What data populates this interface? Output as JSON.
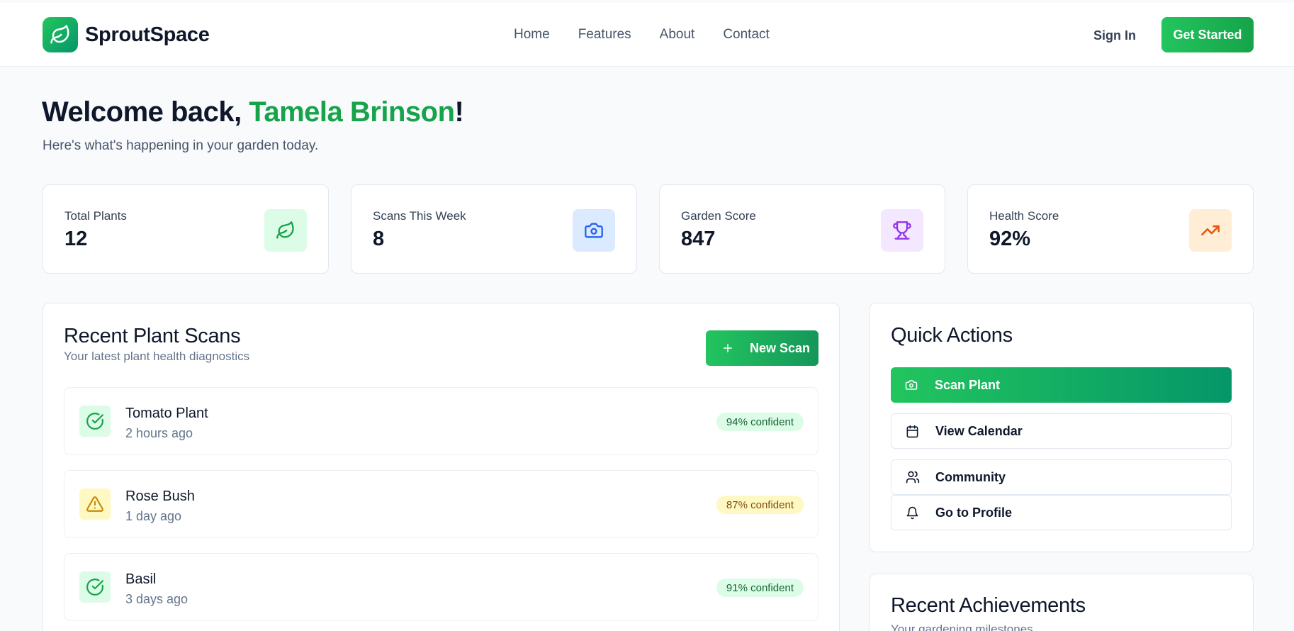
{
  "header": {
    "brand": "SproutSpace",
    "nav": [
      "Home",
      "Features",
      "About",
      "Contact"
    ],
    "sign_in": "Sign In",
    "get_started": "Get Started"
  },
  "welcome": {
    "prefix": "Welcome back, ",
    "name": "Tamela Brinson",
    "suffix": "!",
    "subtitle": "Here's what's happening in your garden today."
  },
  "stats": [
    {
      "label": "Total Plants",
      "value": "12",
      "icon": "leaf-icon",
      "color": "#16a34a",
      "bg": "#dcfce7"
    },
    {
      "label": "Scans This Week",
      "value": "8",
      "icon": "camera-icon",
      "color": "#2563eb",
      "bg": "#dbeafe"
    },
    {
      "label": "Garden Score",
      "value": "847",
      "icon": "trophy-icon",
      "color": "#9333ea",
      "bg": "#f3e8ff"
    },
    {
      "label": "Health Score",
      "value": "92%",
      "icon": "trending-up-icon",
      "color": "#ea580c",
      "bg": "#ffedd5"
    }
  ],
  "scans": {
    "title": "Recent Plant Scans",
    "subtitle": "Your latest plant health diagnostics",
    "new_scan": "New Scan",
    "items": [
      {
        "name": "Tomato Plant",
        "time": "2 hours ago",
        "confidence": "94% confident",
        "status": "healthy",
        "icon": "check-circle-icon"
      },
      {
        "name": "Rose Bush",
        "time": "1 day ago",
        "confidence": "87% confident",
        "status": "warning",
        "icon": "alert-triangle-icon"
      },
      {
        "name": "Basil",
        "time": "3 days ago",
        "confidence": "91% confident",
        "status": "healthy",
        "icon": "check-circle-icon"
      }
    ]
  },
  "quick_actions": {
    "title": "Quick Actions",
    "items": [
      {
        "label": "Scan Plant",
        "icon": "camera-icon"
      },
      {
        "label": "View Calendar",
        "icon": "calendar-icon"
      },
      {
        "label": "Community",
        "icon": "users-icon"
      },
      {
        "label": "Go to Profile",
        "icon": "bell-icon"
      }
    ]
  },
  "achievements": {
    "title": "Recent Achievements",
    "subtitle": "Your gardening milestones"
  },
  "colors": {
    "brand_green": "#16a34a",
    "healthy_bg": "#dcfce7",
    "healthy_text": "#166534",
    "warning_bg": "#fef9c3",
    "warning_text": "#854d0e"
  }
}
